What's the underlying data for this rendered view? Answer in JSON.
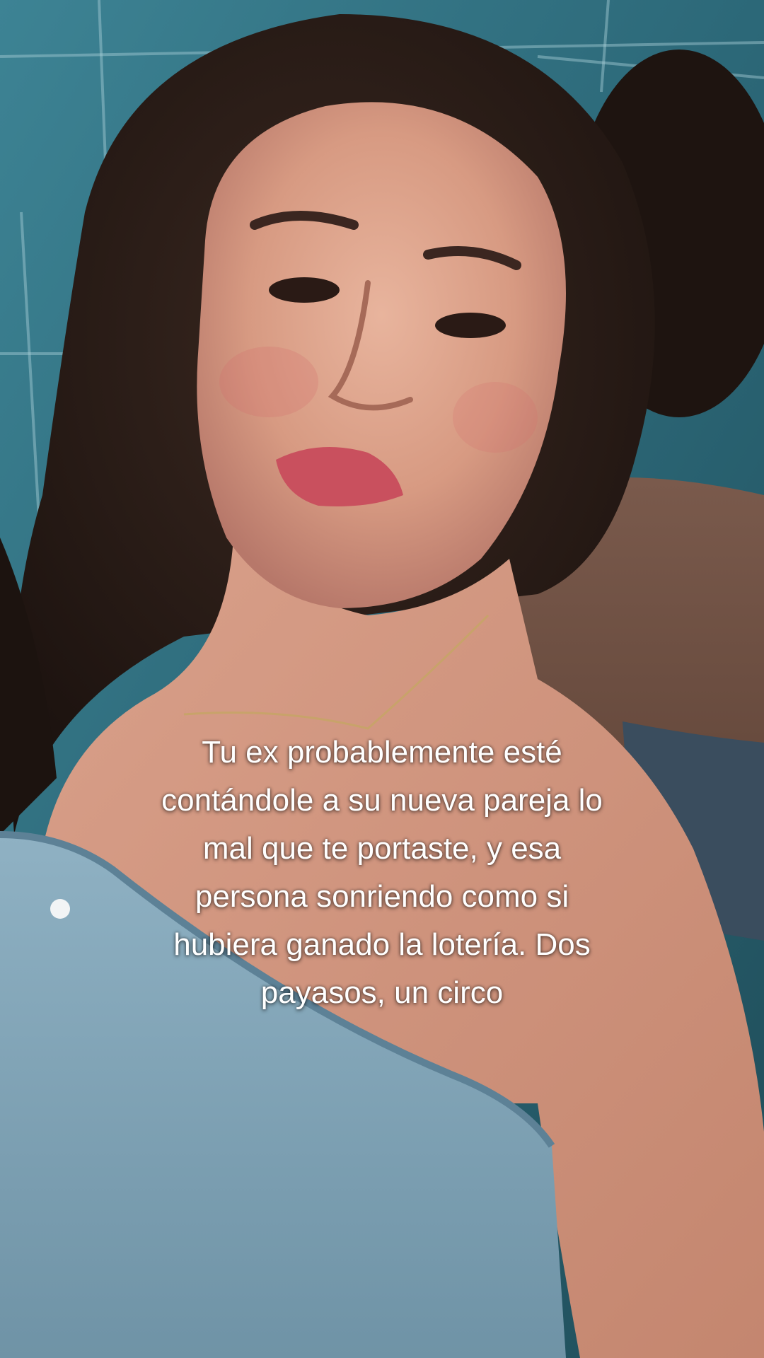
{
  "caption": {
    "lines": [
      "Tu ex probablemente esté",
      "contándole a su nueva pareja lo",
      "mal que te portaste, y esa",
      "persona sonriendo como si",
      "hubiera ganado la lotería. Dos",
      "payasos, un circo"
    ]
  },
  "colors": {
    "tile_wall": "#2f6f7e",
    "hair": "#2a1d18",
    "skin": "#d9a08a",
    "top": "#7fa3b6",
    "lips": "#c9505e",
    "caption_text": "#ffffff"
  }
}
